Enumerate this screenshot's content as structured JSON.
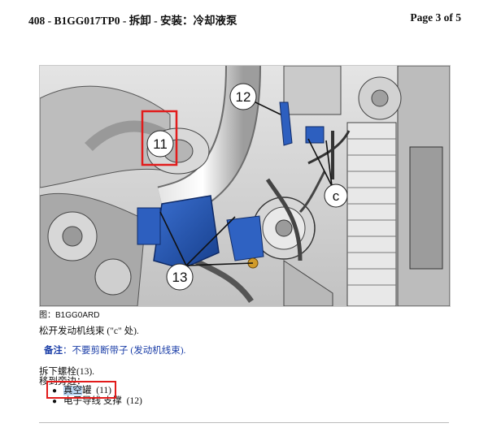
{
  "header": {
    "title": "408 - B1GG017TP0 - 拆卸 - 安装：冷却液泵",
    "page": "Page 3 of 5"
  },
  "figure": {
    "callouts": [
      "11",
      "12",
      "13",
      "c"
    ],
    "caption": "图：B1GG0ARD"
  },
  "content": {
    "step1": "松开发动机线束 (\"c\" 处).",
    "note_label": "备注",
    "note_text": "：不要剪断带子 (发动机线束).",
    "step2": "拆下螺栓(13).",
    "step3": "移到旁边：",
    "items": [
      {
        "text_hl": "真空",
        "text_rest": "罐",
        "ref": "(11)"
      },
      {
        "text_hl": "",
        "text_rest": "电子导线 支撑",
        "ref": "(12)"
      }
    ]
  },
  "colors": {
    "callout_box": "#e21b1b",
    "highlight": "#b9d6f2",
    "part_blue": "#1f4fa8",
    "note_text": "#1c3fa8"
  }
}
